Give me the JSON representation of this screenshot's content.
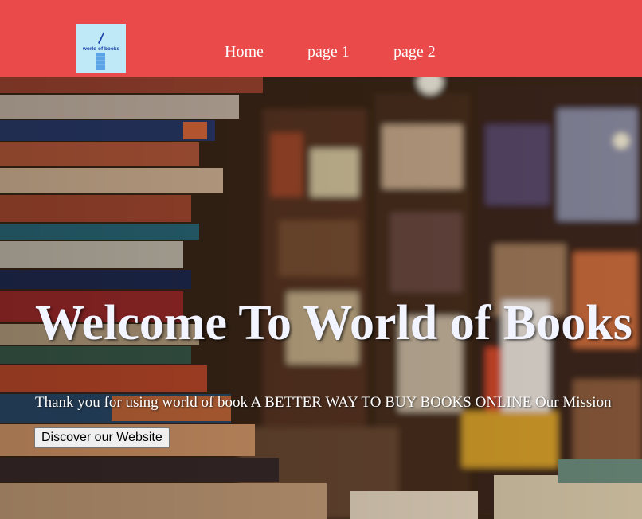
{
  "navbar": {
    "logo": {
      "text": "world of books",
      "background": "#bfe9f7",
      "icon": "book-quill-icon"
    },
    "links": [
      {
        "label": "Home"
      },
      {
        "label": "page 1"
      },
      {
        "label": "page 2"
      }
    ],
    "background": "#ea4a4a"
  },
  "hero": {
    "title": "Welcome To World of Books",
    "text": "Thank you for using world of book A BETTER WAY TO BUY BOOKS ONLINE Our Mission",
    "button_label": "Discover our Website",
    "background": "bookstore-shelves-photo"
  }
}
